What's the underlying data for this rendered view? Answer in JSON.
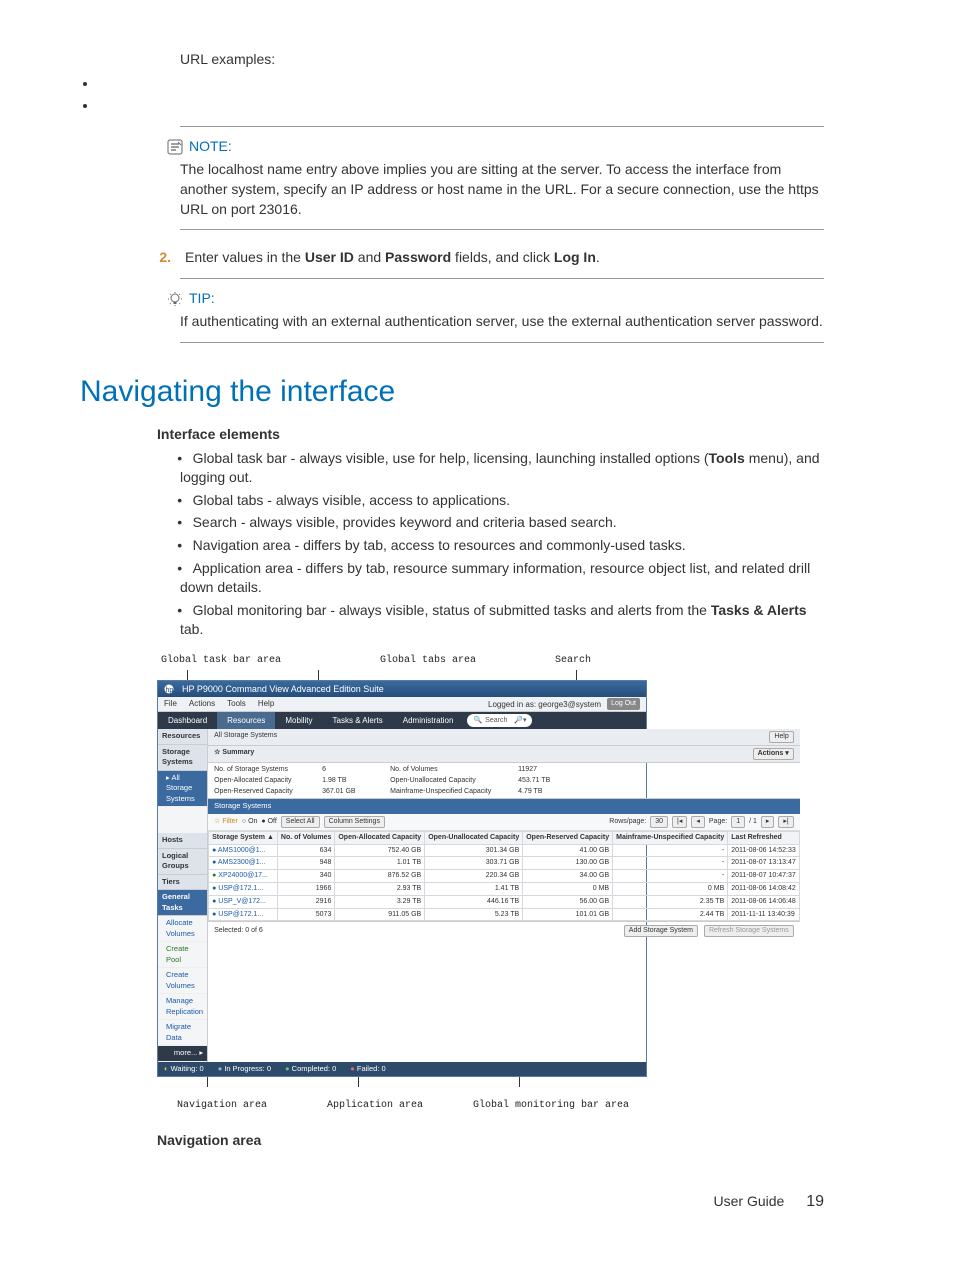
{
  "top": {
    "url_examples": "URL examples:"
  },
  "note": {
    "label": "NOTE:",
    "body": "The localhost name entry above implies you are sitting at the server. To access the interface from another system, specify an IP address or host name in the URL. For a secure connection, use the https URL on port 23016."
  },
  "step2": {
    "num": "2.",
    "pre": "Enter values in the ",
    "uid": "User ID",
    "mid": " and ",
    "pwd": "Password",
    "post": " fields, and click ",
    "login": "Log In",
    "end": "."
  },
  "tip": {
    "label": "TIP:",
    "body": "If authenticating with an external authentication server, use the external authentication server password."
  },
  "section_title": "Navigating the interface",
  "iface_heading": "Interface elements",
  "iface_items": [
    {
      "pre": "Global task bar - always visible, use for help, licensing, launching installed options (",
      "b": "Tools",
      "post": " menu), and logging out."
    },
    {
      "pre": "Global tabs - always visible, access to applications.",
      "b": "",
      "post": ""
    },
    {
      "pre": "Search - always visible, provides keyword and criteria based search.",
      "b": "",
      "post": ""
    },
    {
      "pre": "Navigation area - differs by tab, access to resources and commonly-used tasks.",
      "b": "",
      "post": ""
    },
    {
      "pre": "Application area - differs by tab, resource summary information, resource object list, and related drill down details.",
      "b": "",
      "post": ""
    },
    {
      "pre": "Global monitoring bar - always visible, status of submitted tasks and alerts from the ",
      "b": "Tasks & Alerts",
      "post": " tab."
    }
  ],
  "fig_top_labels": [
    "Global task bar area",
    "Global tabs area",
    "Search"
  ],
  "fig_bot_labels": [
    "Navigation area",
    "Application area",
    "Global monitoring bar area"
  ],
  "app": {
    "title": "HP P9000 Command View Advanced Edition Suite",
    "menus": [
      "File",
      "Actions",
      "Tools",
      "Help"
    ],
    "logged_in": "Logged in as: george3@system",
    "logout": "Log Out",
    "tabs": [
      "Dashboard",
      "Resources",
      "Mobility",
      "Tasks & Alerts",
      "Administration"
    ],
    "search_placeholder": "Search",
    "sidebar": {
      "h1": "Resources",
      "h2": "Storage Systems",
      "sel": "All Storage Systems",
      "h3": "Hosts",
      "h4": "Logical Groups",
      "h5": "Tiers",
      "h6": "General Tasks",
      "tasks": [
        "Allocate Volumes",
        "Create Pool",
        "Create Volumes",
        "Manage Replication",
        "Migrate Data"
      ],
      "more": "more... ▸"
    },
    "main": {
      "breadcrumb": "All Storage Systems",
      "help": "Help",
      "summary_h": "☆ Summary",
      "actions": "Actions ▾",
      "sum": {
        "l1": "No. of Storage Systems",
        "v1": "6",
        "l2": "No. of Volumes",
        "v2": "11927",
        "l3": "Open-Allocated Capacity",
        "v3": "1.98 TB",
        "l4": "Open-Unallocated Capacity",
        "v4": "453.71 TB",
        "l5": "Open-Reserved Capacity",
        "v5": "367.01 GB",
        "l6": "Mainframe-Unspecified Capacity",
        "v6": "4.79 TB"
      },
      "block_h": "Storage Systems",
      "toolbar": {
        "filter": "☆ Filter",
        "on": "○ On",
        "off": "● Off",
        "sel": "Select All",
        "col": "Column Settings",
        "rows": "Rows/page:",
        "rv": "30",
        "page": "Page:",
        "pv": "1",
        "of": "/ 1"
      },
      "cols": [
        "Storage System ▲",
        "No. of Volumes",
        "Open-Allocated Capacity",
        "Open-Unallocated Capacity",
        "Open-Reserved Capacity",
        "Mainframe-Unspecified Capacity",
        "Last Refreshed"
      ],
      "rows": [
        {
          "c": "dotb",
          "n": "AMS1000@1...",
          "v": "634",
          "a": "752.40 GB",
          "u": "301.34 GB",
          "r": "41.00 GB",
          "m": "-",
          "t": "2011-08-06 14:52:33"
        },
        {
          "c": "dotb",
          "n": "AMS2300@1...",
          "v": "948",
          "a": "1.01 TB",
          "u": "303.71 GB",
          "r": "130.00 GB",
          "m": "-",
          "t": "2011-08-07 13:13:47"
        },
        {
          "c": "dotg",
          "n": "XP24000@17...",
          "v": "340",
          "a": "876.52 GB",
          "u": "220.34 GB",
          "r": "34.00 GB",
          "m": "-",
          "t": "2011-08-07 10:47:37"
        },
        {
          "c": "dotb",
          "n": "USP@172.1...",
          "v": "1966",
          "a": "2.93 TB",
          "u": "1.41 TB",
          "r": "0 MB",
          "m": "0 MB",
          "t": "2011-08-06 14:08:42"
        },
        {
          "c": "dotb",
          "n": "USP_V@172...",
          "v": "2916",
          "a": "3.29 TB",
          "u": "446.16 TB",
          "r": "56.00 GB",
          "m": "2.35 TB",
          "t": "2011-08-06 14:06:48"
        },
        {
          "c": "dotb",
          "n": "USP@172.1...",
          "v": "5073",
          "a": "911.05 GB",
          "u": "5.23 TB",
          "r": "101.01 GB",
          "m": "2.44 TB",
          "t": "2011-11-11 13:40:39"
        }
      ],
      "selected": "Selected: 0 of 6",
      "add": "Add Storage System",
      "refresh": "Refresh Storage Systems"
    },
    "status": {
      "w": "Waiting: 0",
      "p": "In Progress: 0",
      "c": "Completed: 0",
      "f": "Failed: 0"
    }
  },
  "nav_area": "Navigation area",
  "footer": {
    "label": "User Guide",
    "page": "19"
  }
}
